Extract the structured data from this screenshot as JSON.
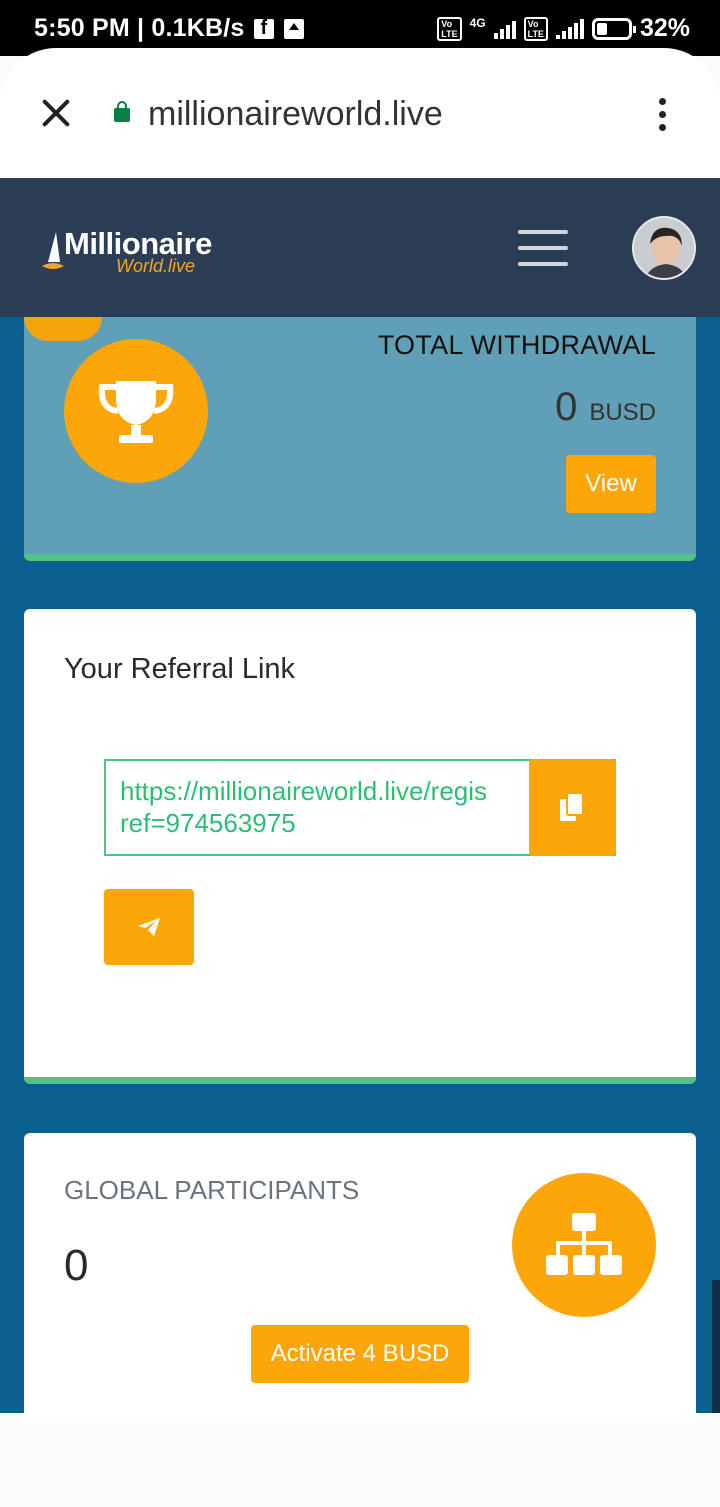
{
  "status_bar": {
    "time_speed": "5:50 PM | 0.1KB/s",
    "network_type": "4G",
    "volte_label": "Vo LTE",
    "battery": "32%",
    "icons": [
      "facebook-icon",
      "upload-icon",
      "volte-icon",
      "signal-icon",
      "battery-icon"
    ]
  },
  "browser": {
    "url": "millionaireworld.live",
    "icons": [
      "close-icon",
      "lock-icon",
      "more-vert-icon"
    ]
  },
  "navbar": {
    "logo_title": "Millionaire",
    "logo_sub": "World.live",
    "icons": [
      "menu-icon",
      "avatar"
    ]
  },
  "withdrawal_card": {
    "title": "TOTAL WITHDRAWAL",
    "value": "0",
    "unit": "BUSD",
    "button": "View",
    "icon": "trophy-icon"
  },
  "referral_card": {
    "title": "Your Referral Link",
    "link_line1": "https://millionaireworld.live/regis",
    "link_line2": "ref=974563975",
    "icons": [
      "copy-icon",
      "telegram-icon"
    ]
  },
  "participants_card": {
    "title": "GLOBAL PARTICIPANTS",
    "value": "0",
    "button": "Activate 4 BUSD",
    "icon": "sitemap-icon"
  },
  "colors": {
    "accent": "#fca60a",
    "navbar": "#2c3e55",
    "page_bg": "#0a5f8e",
    "card1_bg": "#5fa0b6",
    "success": "#4fc487"
  }
}
